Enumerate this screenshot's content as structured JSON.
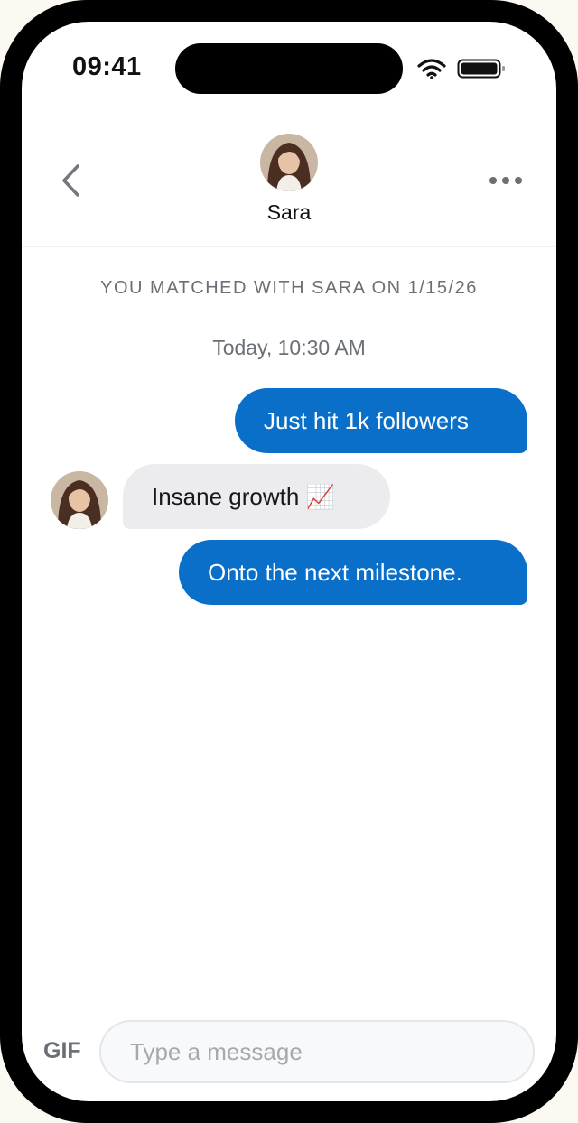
{
  "status_bar": {
    "time": "09:41"
  },
  "header": {
    "contact_name": "Sara"
  },
  "chat": {
    "match_note": "YOU MATCHED WITH SARA ON 1/15/26",
    "timestamp": "Today, 10:30 AM",
    "messages": [
      {
        "direction": "sent",
        "text": "Just hit 1k followers"
      },
      {
        "direction": "received",
        "text": "Insane growth 📈"
      },
      {
        "direction": "sent",
        "text": "Onto the next milestone."
      }
    ]
  },
  "composer": {
    "gif_label": "GIF",
    "placeholder": "Type a message"
  },
  "colors": {
    "sent_bubble": "#0a6fc9",
    "received_bubble": "#ececef",
    "muted_text": "#6b6f76"
  },
  "icons": [
    "wifi-icon",
    "battery-icon",
    "back-chevron-icon",
    "more-dots-icon"
  ]
}
